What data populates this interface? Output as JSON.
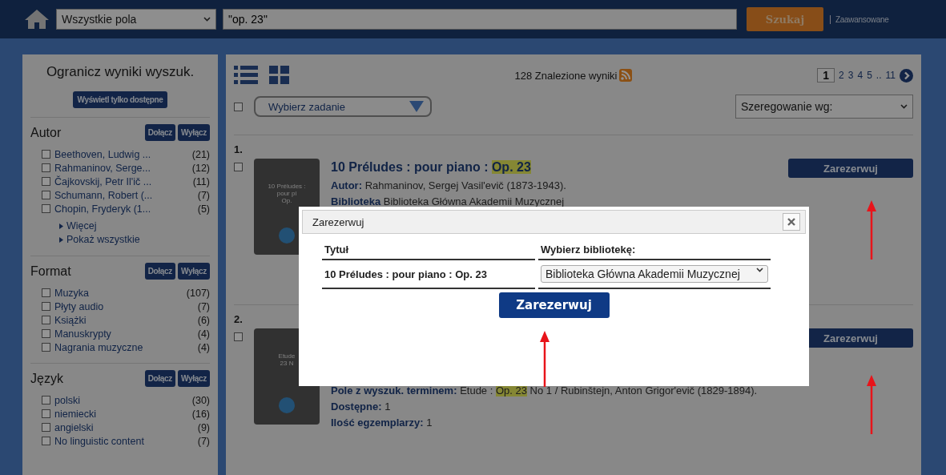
{
  "header": {
    "field_select": "Wszystkie pola",
    "query": "\"op. 23\"",
    "search_button": "Szukaj",
    "advanced_link": "Zaawansowane"
  },
  "sidebar": {
    "title": "Ogranicz wyniki wyszuk.",
    "available_button": "Wyświetl tylko dostępne",
    "facets": [
      {
        "title": "Autor",
        "include_button": "Dołącz",
        "exclude_button": "Wyłącz",
        "items": [
          {
            "label": "Beethoven, Ludwig ...",
            "count": "(21)",
            "checked": false
          },
          {
            "label": "Rahmaninov, Serge...",
            "count": "(12)",
            "checked": false
          },
          {
            "label": "Čajkovskij, Petr Il'ič ...",
            "count": "(11)",
            "checked": false
          },
          {
            "label": "Schumann, Robert (...",
            "count": "(7)",
            "checked": false
          },
          {
            "label": "Chopin, Fryderyk (1...",
            "count": "(5)",
            "checked": false
          }
        ],
        "links": [
          "Więcej",
          "Pokaż wszystkie"
        ]
      },
      {
        "title": "Format",
        "include_button": "Dołącz",
        "exclude_button": "Wyłącz",
        "items": [
          {
            "label": "Muzyka",
            "count": "(107)",
            "checked": false
          },
          {
            "label": "Płyty audio",
            "count": "(7)",
            "checked": false
          },
          {
            "label": "Książki",
            "count": "(6)",
            "checked": false
          },
          {
            "label": "Manuskrypty",
            "count": "(4)",
            "checked": false
          },
          {
            "label": "Nagrania muzyczne",
            "count": "(4)",
            "checked": false
          }
        ]
      },
      {
        "title": "Język",
        "include_button": "Dołącz",
        "exclude_button": "Wyłącz",
        "items": [
          {
            "label": "polski",
            "count": "(30)",
            "checked": false
          },
          {
            "label": "niemiecki",
            "count": "(16)",
            "checked": false
          },
          {
            "label": "angielski",
            "count": "(9)",
            "checked": false
          },
          {
            "label": "No linguistic content",
            "count": "(7)",
            "checked": false
          }
        ]
      }
    ]
  },
  "results_bar": {
    "count": "128 Znalezione wyniki",
    "pages": [
      {
        "label": "1",
        "selected": true
      },
      {
        "label": "2",
        "selected": false
      },
      {
        "label": "3",
        "selected": false
      },
      {
        "label": "4",
        "selected": false
      },
      {
        "label": "5",
        "selected": false
      },
      {
        "label": "..",
        "selected": false
      },
      {
        "label": "11",
        "selected": false
      }
    ],
    "select_all_checked": false,
    "task_dropdown": "Wybierz zadanie",
    "sort_select": "Szeregowanie wg:"
  },
  "results": [
    {
      "number": "1.",
      "checked": false,
      "cover_lines": [
        "10 Préludes :",
        "pour pi",
        "Op."
      ],
      "title": [
        {
          "text": "10 Préludes : pour piano : ",
          "highlight": false
        },
        {
          "text": "Op. 23",
          "highlight": true
        }
      ],
      "fields": [
        {
          "label": "Autor:",
          "value": [
            {
              "text": "Rahmaninov, Sergej Vasil'evič (1873-1943).",
              "highlight": false
            }
          ]
        },
        {
          "label": "Biblioteka",
          "value": [
            {
              "text": "Biblioteka Główna Akademii Muzycznej",
              "highlight": false
            }
          ]
        }
      ],
      "reserve_button": "Zarezerwuj"
    },
    {
      "number": "2.",
      "checked": false,
      "cover_lines": [
        "Etude",
        "23 N"
      ],
      "fields": [
        {
          "label": "Pole z wyszuk. terminem:",
          "value": [
            {
              "text": "Etude : ",
              "highlight": false
            },
            {
              "text": "Op. 23",
              "highlight": true
            },
            {
              "text": " No 1 / Rubinštejn, Anton Grigor'evič (1829-1894).",
              "highlight": false
            }
          ]
        },
        {
          "label": "Dostępne:",
          "value": [
            {
              "text": "1",
              "highlight": false
            }
          ]
        },
        {
          "label": "Ilość egzemplarzy:",
          "value": [
            {
              "text": "1",
              "highlight": false
            }
          ]
        }
      ],
      "reserve_button": "Zarezerwuj"
    }
  ],
  "modal": {
    "title": "Zarezerwuj",
    "columns": [
      "Tytuł",
      "Wybierz bibliotekę:"
    ],
    "item_title": "10 Préludes : pour piano : Op. 23",
    "library_select": "Biblioteka Główna Akademii Muzycznej",
    "submit_button": "Zarezerwuj"
  }
}
